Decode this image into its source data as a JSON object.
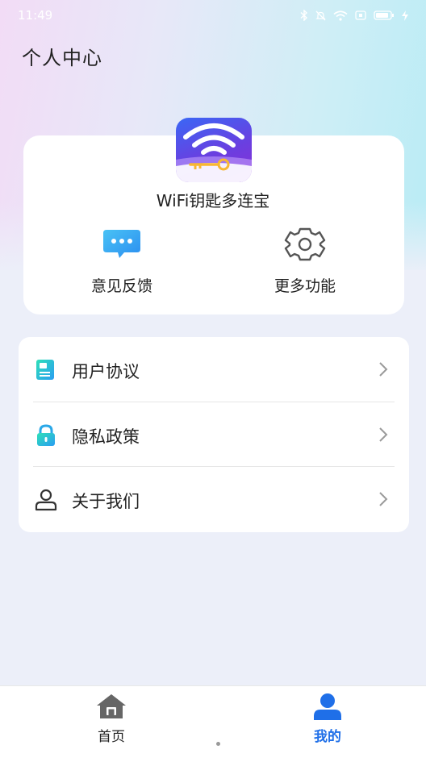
{
  "status": {
    "time": "11:49"
  },
  "header": {
    "title": "个人中心"
  },
  "app": {
    "name": "WiFi钥匙多连宝"
  },
  "quick_actions": [
    {
      "label": "意见反馈",
      "icon": "chat-bubble-icon"
    },
    {
      "label": "更多功能",
      "icon": "gear-icon"
    }
  ],
  "menu": {
    "items": [
      {
        "label": "用户协议",
        "icon": "document-icon"
      },
      {
        "label": "隐私政策",
        "icon": "lock-icon"
      },
      {
        "label": "关于我们",
        "icon": "person-icon"
      }
    ]
  },
  "tabbar": {
    "home": "首页",
    "mine": "我的"
  },
  "colors": {
    "accent": "#1f6fe8",
    "icon_gray": "#555555"
  }
}
